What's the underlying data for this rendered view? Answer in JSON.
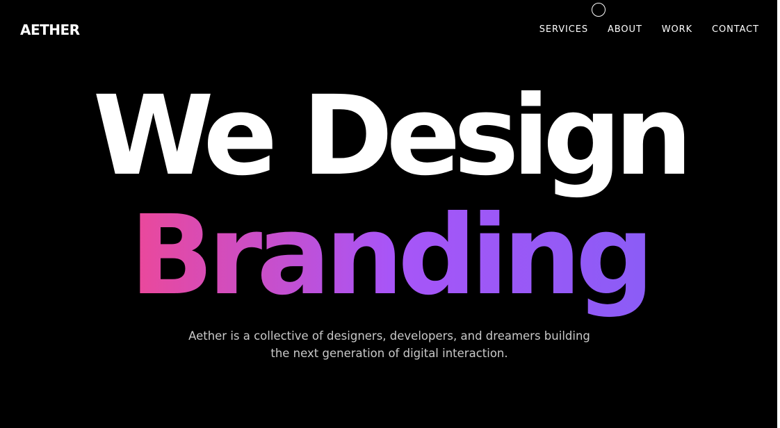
{
  "header": {
    "logo": "AETHER",
    "nav": [
      {
        "label": "SERVICES"
      },
      {
        "label": "ABOUT"
      },
      {
        "label": "WORK"
      },
      {
        "label": "CONTACT"
      }
    ]
  },
  "hero": {
    "line1": "We Design",
    "line2": "Branding",
    "tagline": "Aether is a collective of designers, developers, and dreamers building the next generation of digital interaction."
  },
  "colors": {
    "background": "#000000",
    "text": "#ffffff",
    "gradient_start": "#ec4899",
    "gradient_mid": "#a855f7",
    "gradient_end": "#8b5cf6",
    "tagline": "#c9c9c9"
  },
  "icons": {
    "cursor": "custom-cursor-ring-icon"
  }
}
